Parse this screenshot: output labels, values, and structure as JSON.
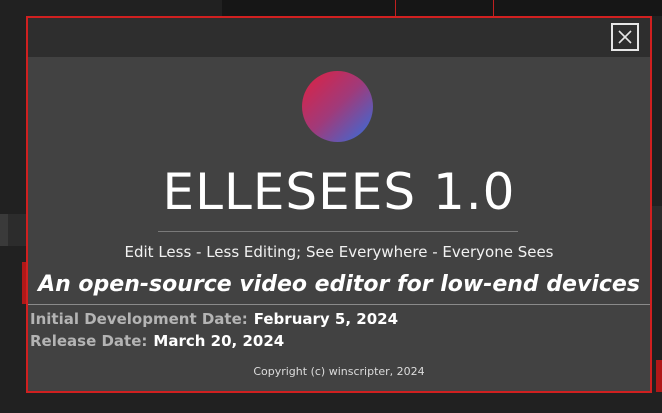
{
  "dialog": {
    "close_label": "Close",
    "app_title": "ELLESEES 1.0",
    "tagline": "Edit Less - Less Editing; See Everywhere - Everyone Sees",
    "subtitle": "An open-source video editor for low-end devices",
    "initial_dev_label": "Initial Development Date:",
    "initial_dev_value": "February 5, 2024",
    "release_label": "Release Date:",
    "release_value": "March 20, 2024",
    "copyright": "Copyright (c) winscripter, 2024"
  },
  "colors": {
    "accent_border": "#d02020",
    "logo_gradient": [
      "#e02040",
      "#a03a7a",
      "#3070e0"
    ],
    "dialog_background": "#424242"
  },
  "icons": {
    "close": "close-icon",
    "logo": "app-logo"
  }
}
